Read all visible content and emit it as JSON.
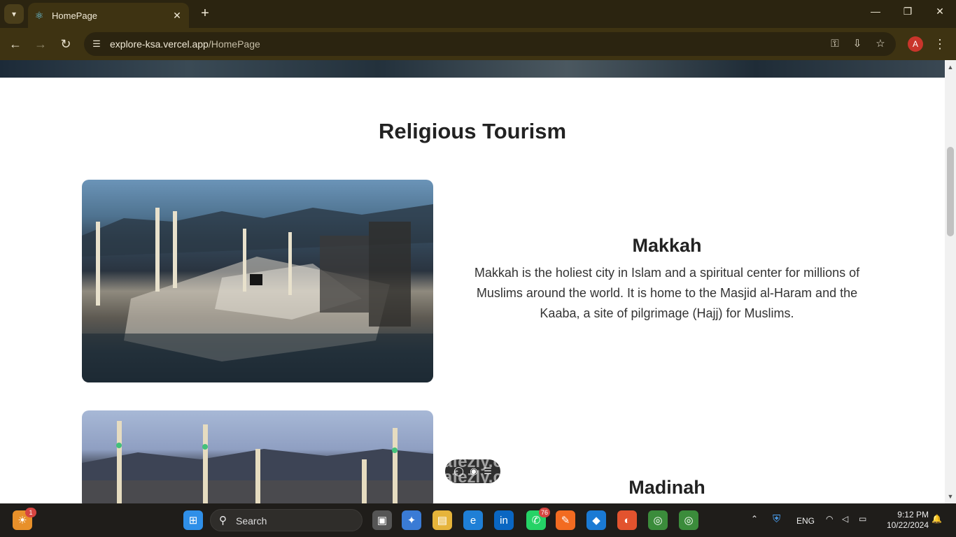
{
  "browser": {
    "tab_title": "HomePage",
    "url_host": "explore-ksa.vercel.app",
    "url_path": "/HomePage",
    "profile_initial": "A"
  },
  "page": {
    "section_title": "Religious Tourism",
    "places": [
      {
        "title": "Makkah",
        "description": "Makkah is the holiest city in Islam and a spiritual center for millions of Muslims around the world. It is home to the Masjid al-Haram and the Kaaba, a site of pilgrimage (Hajj) for Muslims."
      },
      {
        "title": "Madinah"
      }
    ]
  },
  "taskbar": {
    "search_placeholder": "Search",
    "language": "ENG",
    "time": "9:12 PM",
    "date": "10/22/2024",
    "weather_badge": "1",
    "whatsapp_badge": "76"
  },
  "watermark": {
    "text_top": "nafezly.com",
    "text_bottom": "nafezly.com"
  },
  "colors": {
    "tabbar_bg": "#2b2410",
    "toolbar_bg": "#3e3312",
    "taskbar_bg": "#1f1d1a"
  }
}
